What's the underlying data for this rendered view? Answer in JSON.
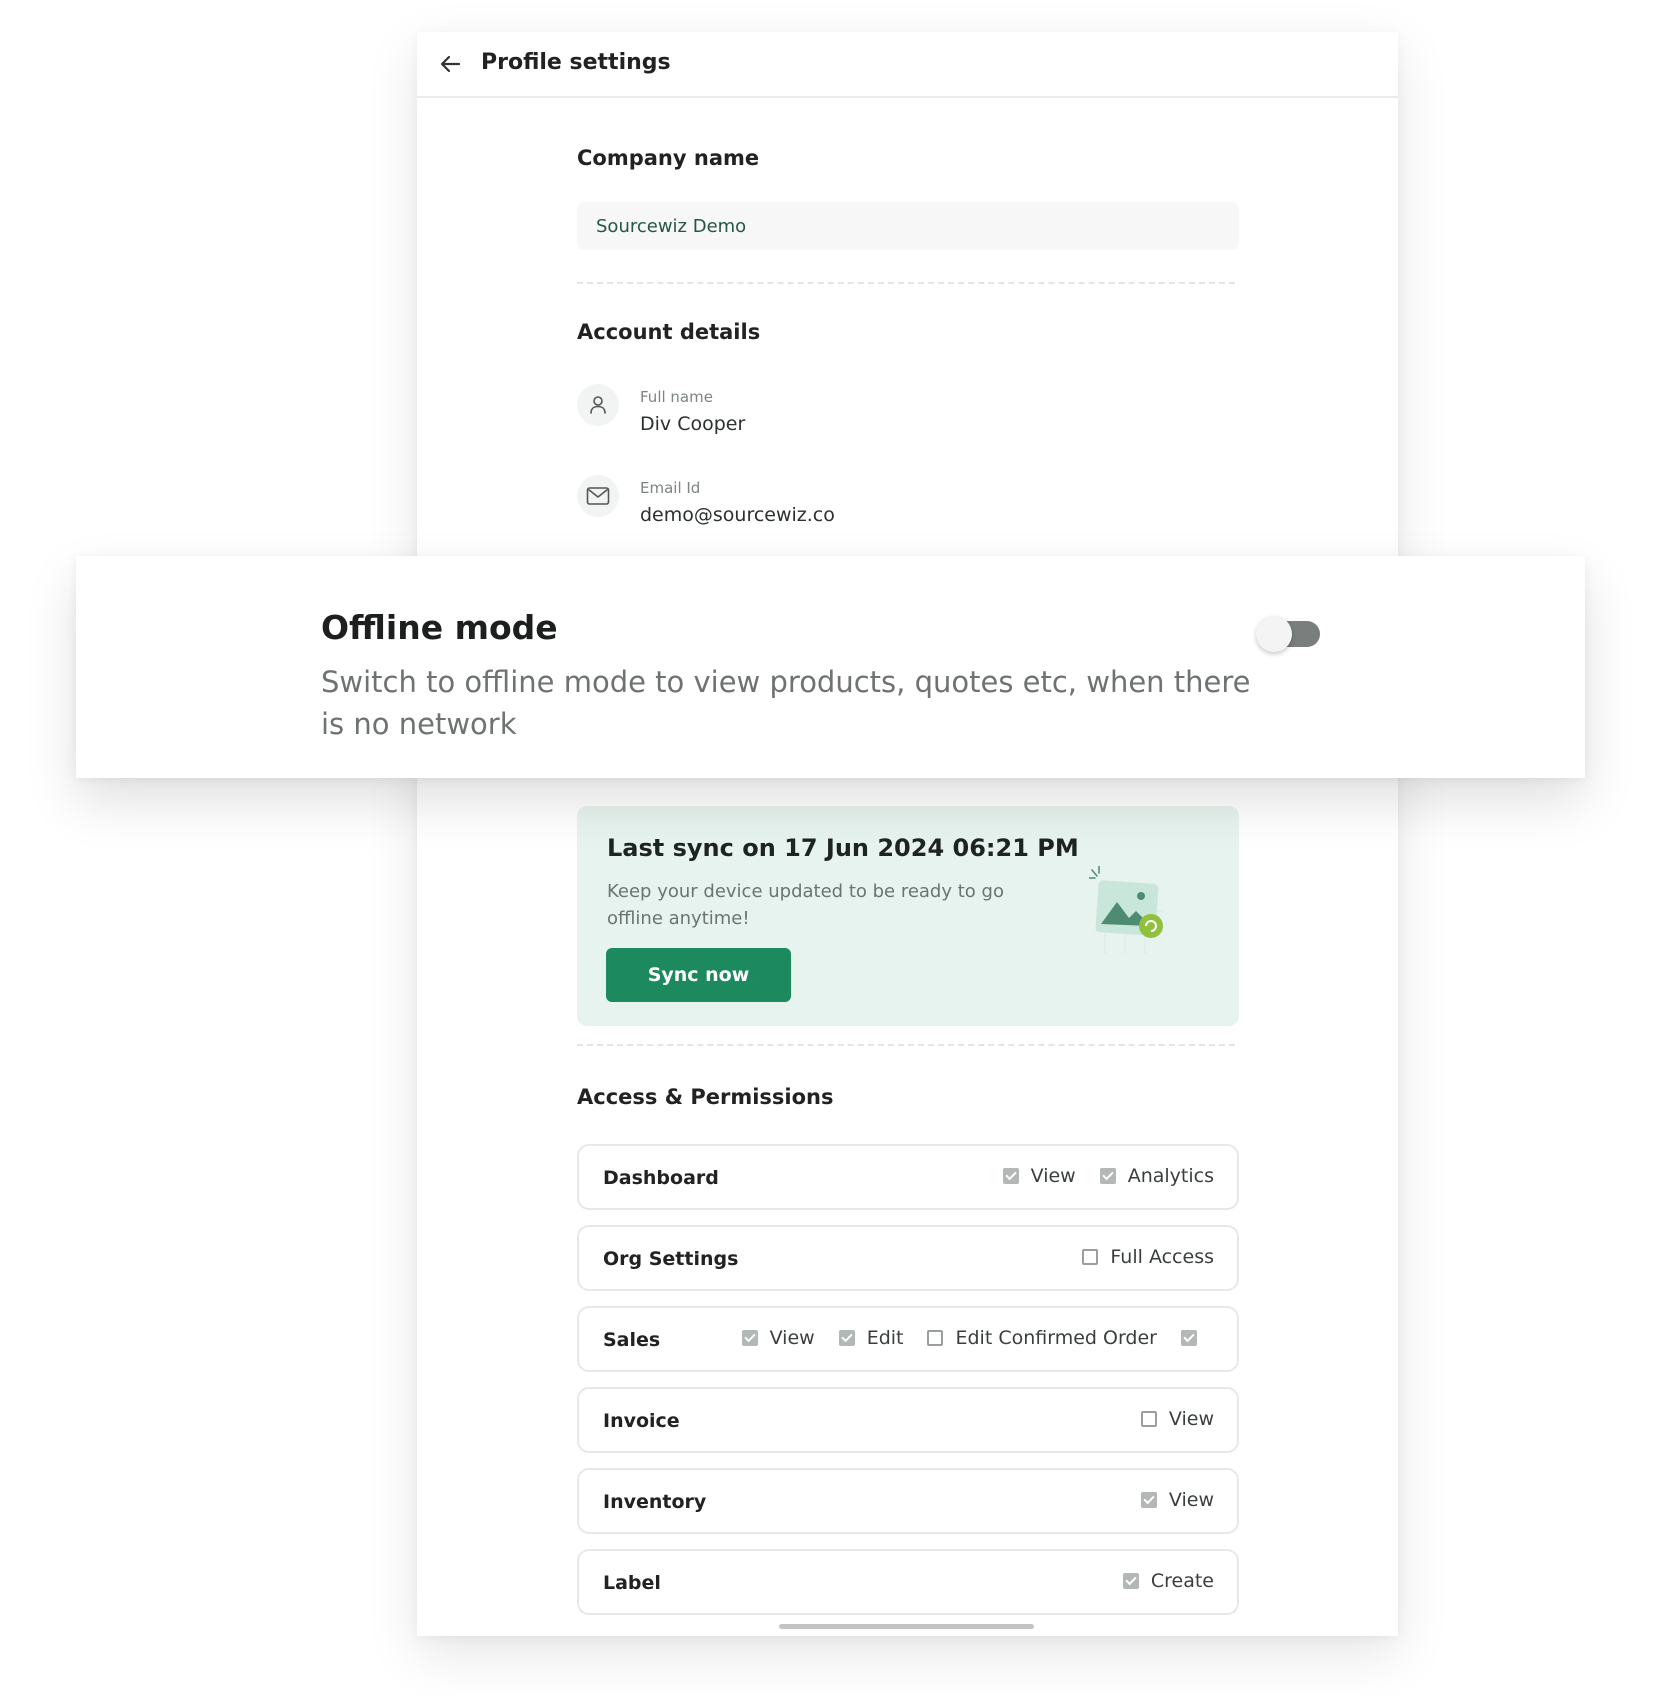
{
  "header": {
    "title": "Profile settings",
    "back_icon": "arrow-left-icon"
  },
  "company": {
    "section_title": "Company name",
    "value": "Sourcewiz Demo"
  },
  "account": {
    "section_title": "Account details",
    "full_name_label": "Full name",
    "full_name_value": "Div Cooper",
    "email_label": "Email Id",
    "email_value": "demo@sourcewiz.co"
  },
  "offline": {
    "title": "Offline mode",
    "description": "Switch to offline mode to view products, quotes etc, when there is no network",
    "enabled": false
  },
  "sync": {
    "title": "Last sync on 17 Jun 2024 06:21 PM",
    "description": "Keep your device updated to be ready to go offline anytime!",
    "button_label": "Sync now",
    "accent": "#1c8a5e",
    "card_bg": "#e7f3ee"
  },
  "permissions": {
    "section_title": "Access & Permissions",
    "rows": [
      {
        "name": "Dashboard",
        "options": [
          {
            "label": "View",
            "checked": true
          },
          {
            "label": "Analytics",
            "checked": true
          }
        ]
      },
      {
        "name": "Org Settings",
        "options": [
          {
            "label": "Full Access",
            "checked": false
          }
        ]
      },
      {
        "name": "Sales",
        "options": [
          {
            "label": "View",
            "checked": true
          },
          {
            "label": "Edit",
            "checked": true
          },
          {
            "label": "Edit Confirmed Order",
            "checked": false
          }
        ],
        "overflow_checkbox_checked": true
      },
      {
        "name": "Invoice",
        "options": [
          {
            "label": "View",
            "checked": false
          }
        ]
      },
      {
        "name": "Inventory",
        "options": [
          {
            "label": "View",
            "checked": true
          }
        ]
      },
      {
        "name": "Label",
        "options": [
          {
            "label": "Create",
            "checked": true
          }
        ]
      }
    ]
  }
}
